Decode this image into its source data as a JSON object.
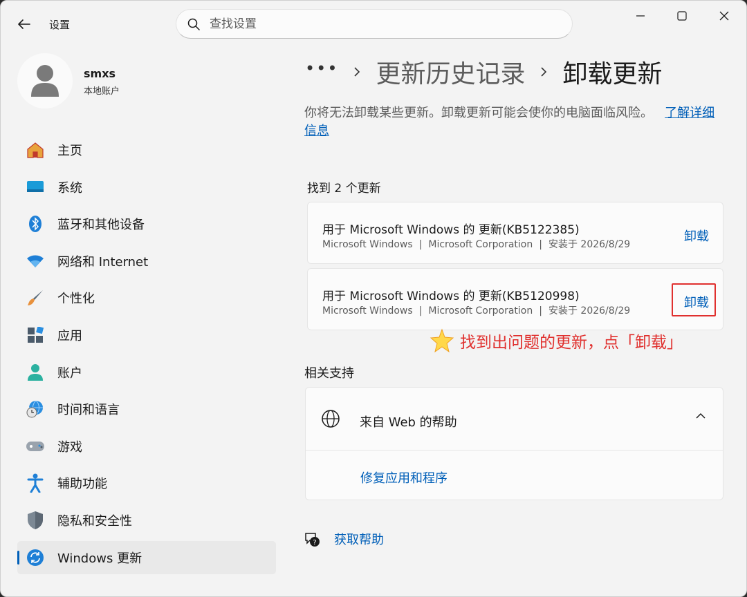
{
  "window": {
    "title": "设置",
    "search_placeholder": "查找设置"
  },
  "profile": {
    "name": "smxs",
    "type": "本地账户"
  },
  "sidebar": {
    "items": [
      {
        "label": "主页",
        "icon": "home-icon"
      },
      {
        "label": "系统",
        "icon": "monitor-icon"
      },
      {
        "label": "蓝牙和其他设备",
        "icon": "bluetooth-icon"
      },
      {
        "label": "网络和 Internet",
        "icon": "wifi-icon"
      },
      {
        "label": "个性化",
        "icon": "brush-icon"
      },
      {
        "label": "应用",
        "icon": "apps-icon"
      },
      {
        "label": "账户",
        "icon": "account-icon"
      },
      {
        "label": "时间和语言",
        "icon": "globe-clock-icon"
      },
      {
        "label": "游戏",
        "icon": "gamepad-icon"
      },
      {
        "label": "辅助功能",
        "icon": "accessibility-icon"
      },
      {
        "label": "隐私和安全性",
        "icon": "shield-icon"
      },
      {
        "label": "Windows 更新",
        "icon": "sync-icon",
        "active": true
      }
    ]
  },
  "breadcrumb": {
    "more": "•••",
    "parent": "更新历史记录",
    "current": "卸载更新"
  },
  "main": {
    "description": "你将无法卸载某些更新。卸载更新可能会使你的电脑面临风险。",
    "learn_more": "了解详细信息",
    "found_count": "找到 2 个更新",
    "updates": [
      {
        "title": "用于 Microsoft Windows 的 更新(KB5122385)",
        "product": "Microsoft Windows",
        "publisher": "Microsoft Corporation",
        "installed": "安装于 2026/8/29",
        "action": "卸载"
      },
      {
        "title": "用于 Microsoft Windows 的 更新(KB5120998)",
        "product": "Microsoft Windows",
        "publisher": "Microsoft Corporation",
        "installed": "安装于 2026/8/29",
        "action": "卸载"
      }
    ],
    "meta_separator": "|",
    "annotation": "找到出问题的更新，点「卸载」",
    "related_title": "相关支持",
    "help_web": "来自 Web 的帮助",
    "help_link": "修复应用和程序",
    "get_help": "获取帮助"
  },
  "colors": {
    "accent": "#005fb8",
    "annotation": "#e0302e",
    "background": "#f3f3f3",
    "card": "#fbfbfb"
  }
}
